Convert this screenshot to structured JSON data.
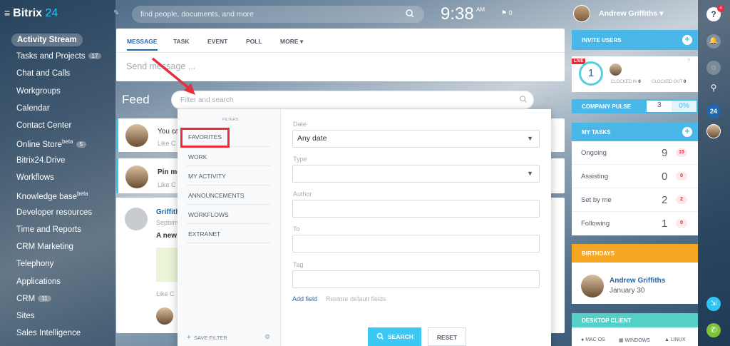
{
  "app": {
    "name": "Bitrix",
    "num": "24"
  },
  "sidebar": {
    "items": [
      {
        "label": "Activity Stream"
      },
      {
        "label": "Tasks and Projects",
        "badge": "17"
      },
      {
        "label": "Chat and Calls"
      },
      {
        "label": "Workgroups"
      },
      {
        "label": "Calendar"
      },
      {
        "label": "Contact Center"
      },
      {
        "label": "Online Store",
        "sup": "beta",
        "badge": "5"
      },
      {
        "label": "Bitrix24.Drive"
      },
      {
        "label": "Workflows"
      },
      {
        "label": "Knowledge base",
        "sup": "beta"
      },
      {
        "label": "Developer resources"
      },
      {
        "label": "Time and Reports"
      },
      {
        "label": "CRM Marketing"
      },
      {
        "label": "Telephony"
      },
      {
        "label": "Applications"
      },
      {
        "label": "CRM",
        "badge": "11"
      },
      {
        "label": "Sites"
      },
      {
        "label": "Sales Intelligence"
      }
    ]
  },
  "header": {
    "search_placeholder": "find people, documents, and more",
    "time": "9:38",
    "ampm": "AM",
    "flag_count": "0",
    "user_name": "Andrew Griffiths",
    "rail_badge": "4",
    "rail_count": "24"
  },
  "composer": {
    "tabs": [
      "MESSAGE",
      "TASK",
      "EVENT",
      "POLL",
      "MORE"
    ],
    "placeholder": "Send message ..."
  },
  "feed": {
    "title": "Feed",
    "posts": [
      {
        "text": "You ca",
        "like": "Like   C"
      },
      {
        "text": "Pin me",
        "like": "Like   C"
      },
      {
        "author": "Griffith",
        "date": "Septem",
        "text": "A new",
        "like": "Like   C"
      }
    ]
  },
  "filter": {
    "placeholder": "Filter and search",
    "header": "FILTERS",
    "presets": [
      "FAVORITES",
      "WORK",
      "MY ACTIVITY",
      "ANNOUNCEMENTS",
      "WORKFLOWS",
      "EXTRANET"
    ],
    "save": "SAVE FILTER",
    "fields": {
      "date_label": "Date",
      "date_value": "Any date",
      "type_label": "Type",
      "author_label": "Author",
      "to_label": "To",
      "tag_label": "Tag"
    },
    "add_field": "Add field",
    "restore": "Restore default fields",
    "search_btn": "SEARCH",
    "reset_btn": "RESET"
  },
  "widgets": {
    "invite": "INVITE USERS",
    "live": "LIVE",
    "clock_count": "1",
    "clocked_in": "CLOCKED IN",
    "clocked_in_n": "0",
    "clocked_out": "CLOCKED OUT",
    "clocked_out_n": "0",
    "pulse": "COMPANY PULSE",
    "pulse_n": "3",
    "pulse_pct": "0%",
    "tasks_title": "MY TASKS",
    "tasks": [
      {
        "label": "Ongoing",
        "n": "9",
        "badge": "15"
      },
      {
        "label": "Assisting",
        "n": "0",
        "badge": "0"
      },
      {
        "label": "Set by me",
        "n": "2",
        "badge": "2"
      },
      {
        "label": "Following",
        "n": "1",
        "badge": "0"
      }
    ],
    "birthdays": "BIRTHDAYS",
    "bday_name": "Andrew Griffiths",
    "bday_date": "January 30",
    "desktop": "DESKTOP CLIENT",
    "os": [
      "MAC OS",
      "WINDOWS",
      "LINUX"
    ]
  },
  "colors": {
    "accent": "#2fc6f6",
    "highlight": "#e62e3c",
    "orange": "#f5a623",
    "teal": "#55d0e0"
  }
}
